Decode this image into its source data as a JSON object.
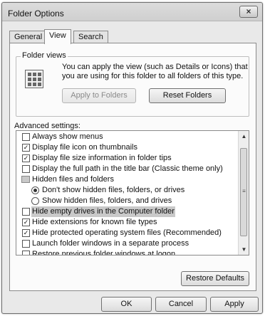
{
  "window": {
    "title": "Folder Options",
    "close_glyph": "×"
  },
  "tabs": [
    {
      "label": "General",
      "active": false
    },
    {
      "label": "View",
      "active": true
    },
    {
      "label": "Search",
      "active": false
    }
  ],
  "folder_views": {
    "label": "Folder views",
    "description": "You can apply the view (such as Details or Icons) that you are using for this folder to all folders of this type.",
    "icon": "folder-view-icon",
    "apply_button": "Apply to Folders",
    "reset_button": "Reset Folders"
  },
  "advanced": {
    "label": "Advanced settings:",
    "items": [
      {
        "label": "Always show menus",
        "kind": "checkbox",
        "checked": false
      },
      {
        "label": "Display file icon on thumbnails",
        "kind": "checkbox",
        "checked": true
      },
      {
        "label": "Display file size information in folder tips",
        "kind": "checkbox",
        "checked": true
      },
      {
        "label": "Display the full path in the title bar (Classic theme only)",
        "kind": "checkbox",
        "checked": false
      },
      {
        "label": "Hidden files and folders",
        "kind": "folder"
      },
      {
        "label": "Don't show hidden files, folders, or drives",
        "kind": "radio",
        "checked": true
      },
      {
        "label": "Show hidden files, folders, and drives",
        "kind": "radio",
        "checked": false
      },
      {
        "label": "Hide empty drives in the Computer folder",
        "kind": "checkbox",
        "checked": false,
        "highlighted": true
      },
      {
        "label": "Hide extensions for known file types",
        "kind": "checkbox",
        "checked": true
      },
      {
        "label": "Hide protected operating system files (Recommended)",
        "kind": "checkbox",
        "checked": true
      },
      {
        "label": "Launch folder windows in a separate process",
        "kind": "checkbox",
        "checked": false
      },
      {
        "label": "Restore previous folder windows at logon",
        "kind": "checkbox",
        "checked": false
      }
    ],
    "check_glyph": "✓",
    "scroll_up": "▲",
    "scroll_down": "▼",
    "scroll_grip": "≡",
    "restore_button": "Restore Defaults"
  },
  "footer": {
    "ok": "OK",
    "cancel": "Cancel",
    "apply": "Apply"
  }
}
